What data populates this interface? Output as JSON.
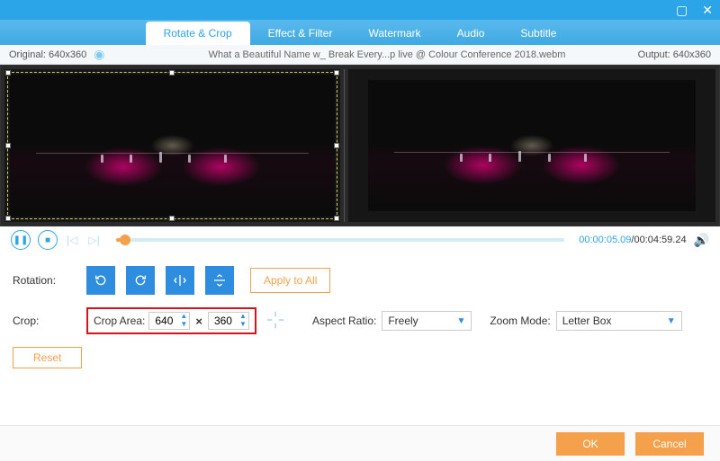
{
  "window": {
    "maximize_icon": "▢",
    "close_icon": "✕"
  },
  "tabs": {
    "rotate_crop": "Rotate & Crop",
    "effect_filter": "Effect & Filter",
    "watermark": "Watermark",
    "audio": "Audio",
    "subtitle": "Subtitle"
  },
  "info": {
    "original_label": "Original: 640x360",
    "filename": "What a Beautiful Name w_ Break Every...p live @ Colour Conference 2018.webm",
    "output_label": "Output: 640x360"
  },
  "player": {
    "current_time": "00:00:05.09",
    "total_time": "/00:04:59.24"
  },
  "rotation": {
    "label": "Rotation:",
    "apply_all": "Apply to All"
  },
  "crop": {
    "label": "Crop:",
    "area_label": "Crop Area:",
    "width": "640",
    "height": "360",
    "aspect_label": "Aspect Ratio:",
    "aspect_value": "Freely",
    "zoom_label": "Zoom Mode:",
    "zoom_value": "Letter Box",
    "reset": "Reset"
  },
  "footer": {
    "ok": "OK",
    "cancel": "Cancel"
  }
}
